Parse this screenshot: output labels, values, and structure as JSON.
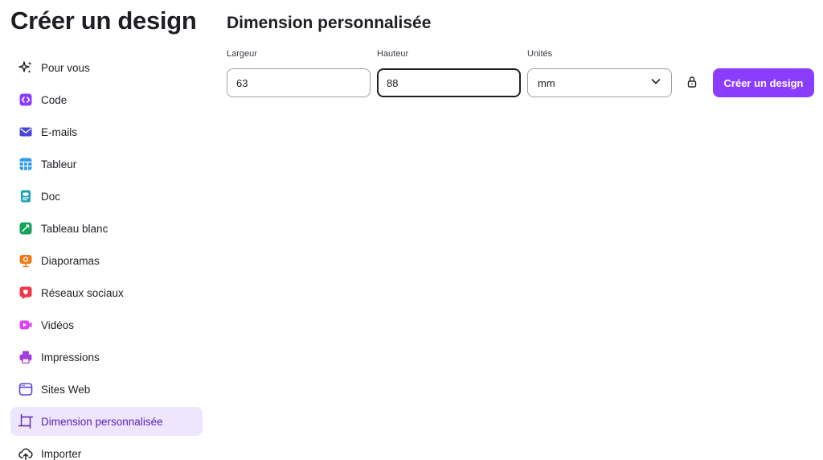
{
  "sidebar": {
    "title": "Créer un design",
    "items": [
      {
        "label": "Pour vous",
        "icon": "sparkle-icon",
        "color": "#1d1f24",
        "active": false
      },
      {
        "label": "Code",
        "icon": "code-icon",
        "color": "#8b3dff",
        "active": false
      },
      {
        "label": "E-mails",
        "icon": "email-icon",
        "color": "#4b47d6",
        "active": false
      },
      {
        "label": "Tableur",
        "icon": "spreadsheet-icon",
        "color": "#2e9be6",
        "active": false
      },
      {
        "label": "Doc",
        "icon": "doc-icon",
        "color": "#17a0b5",
        "active": false
      },
      {
        "label": "Tableau blanc",
        "icon": "whiteboard-icon",
        "color": "#13a35b",
        "active": false
      },
      {
        "label": "Diaporamas",
        "icon": "presentation-icon",
        "color": "#f07a1a",
        "active": false
      },
      {
        "label": "Réseaux sociaux",
        "icon": "social-heart-icon",
        "color": "#f0384a",
        "active": false
      },
      {
        "label": "Vidéos",
        "icon": "video-icon",
        "color": "#d946ef",
        "active": false
      },
      {
        "label": "Impressions",
        "icon": "printer-icon",
        "color": "#a63ddf",
        "active": false
      },
      {
        "label": "Sites Web",
        "icon": "website-icon",
        "color": "#5a46e0",
        "active": false
      },
      {
        "label": "Dimension personnalisée",
        "icon": "custom-size-icon",
        "color": "#5b21b6",
        "active": true
      },
      {
        "label": "Importer",
        "icon": "upload-cloud-icon",
        "color": "#1d1f24",
        "active": false
      }
    ]
  },
  "custom_size": {
    "title": "Dimension personnalisée",
    "width_label": "Largeur",
    "width_value": "63",
    "height_label": "Hauteur",
    "height_value": "88",
    "units_label": "Unités",
    "units_value": "mm",
    "lock_icon": "lock-open-icon",
    "create_button": "Créer un design"
  },
  "colors": {
    "accent": "#8b3dff",
    "active_bg": "#eee6fc",
    "active_text": "#5b21b6"
  }
}
